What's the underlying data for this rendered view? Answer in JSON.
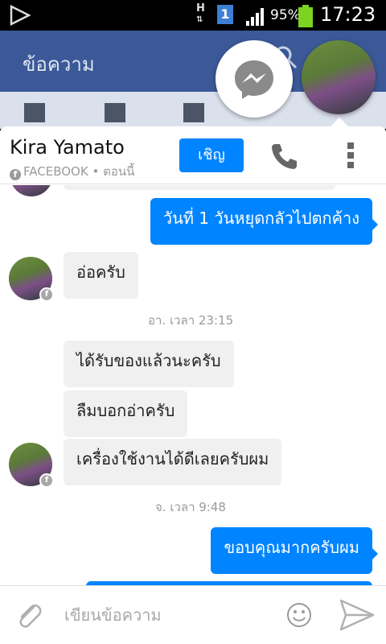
{
  "status_bar": {
    "network_type": "H",
    "sim_slot": "1",
    "battery_percent": "95%",
    "time": "17:23"
  },
  "background_app": {
    "title": "ข้อความ"
  },
  "header": {
    "contact_name": "Kira Yamato",
    "source": "FACEBOOK",
    "presence": "• ตอนนี้",
    "invite_label": "เชิญ"
  },
  "messages": [
    {
      "direction": "out",
      "text": "วันที่ 1 วันหยุดกลัวไปตกค้าง"
    },
    {
      "direction": "in",
      "text": "อ่อครับ"
    },
    {
      "type": "timestamp",
      "text": "อา. เวลา 23:15"
    },
    {
      "direction": "in",
      "text": "ได้รับของแล้วนะครับ"
    },
    {
      "direction": "in",
      "text": "ลืมบอกอ่าครับ"
    },
    {
      "direction": "in",
      "text": "เครื่องใช้งานได้ดีเลยครับผม"
    },
    {
      "type": "timestamp",
      "text": "จ. เวลา 9:48"
    },
    {
      "direction": "out",
      "text": "ขอบคุณมากครับผม"
    }
  ],
  "composer": {
    "placeholder": "เขียนข้อความ"
  },
  "colors": {
    "accent": "#0084ff",
    "facebook_blue": "#3b5998",
    "incoming_bubble": "#f0f0f0"
  },
  "icons": [
    "play-icon",
    "signal-icon",
    "battery-icon",
    "messenger-icon",
    "phone-icon",
    "more-icon",
    "attach-icon",
    "emoji-icon",
    "send-icon",
    "facebook-icon"
  ]
}
